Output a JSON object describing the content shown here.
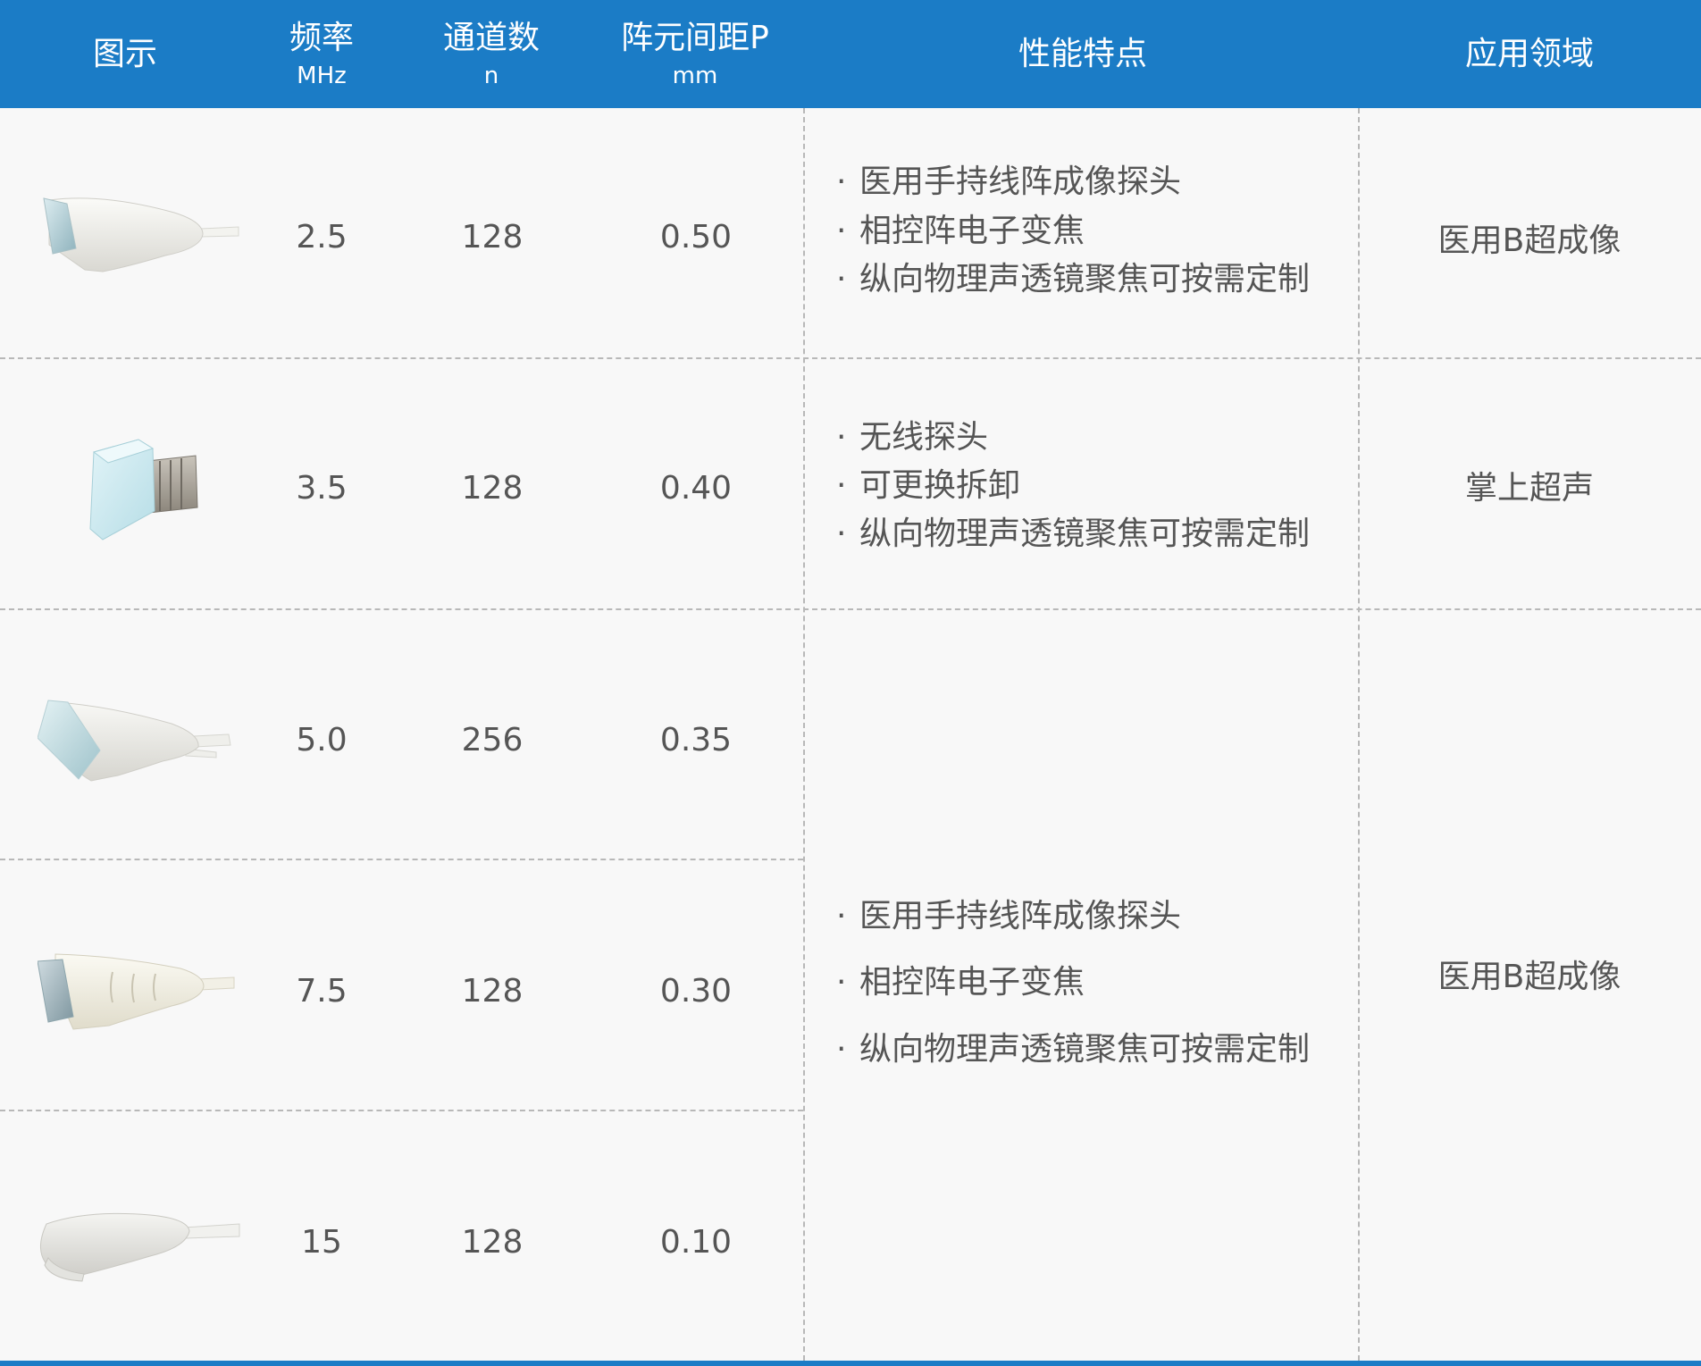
{
  "header": {
    "col_image": "图示",
    "col_freq": "频率",
    "col_freq_unit": "MHz",
    "col_channels": "通道数",
    "col_channels_unit": "n",
    "col_pitch": "阵元间距P",
    "col_pitch_unit": "mm",
    "col_features": "性能特点",
    "col_application": "应用领域"
  },
  "rows": [
    {
      "image": "linear-probe-icon",
      "freq": "2.5",
      "channels": "128",
      "pitch": "0.50"
    },
    {
      "image": "wireless-probe-icon",
      "freq": "3.5",
      "channels": "128",
      "pitch": "0.40"
    },
    {
      "image": "linear-probe-icon",
      "freq": "5.0",
      "channels": "256",
      "pitch": "0.35"
    },
    {
      "image": "linear-probe-icon",
      "freq": "7.5",
      "channels": "128",
      "pitch": "0.30"
    },
    {
      "image": "linear-probe-icon",
      "freq": "15",
      "channels": "128",
      "pitch": "0.10"
    }
  ],
  "features": {
    "group1": [
      "医用手持线阵成像探头",
      "相控阵电子变焦",
      "纵向物理声透镜聚焦可按需定制"
    ],
    "group2": [
      "无线探头",
      "可更换拆卸",
      "纵向物理声透镜聚焦可按需定制"
    ],
    "group3": [
      "医用手持线阵成像探头",
      "相控阵电子变焦",
      "纵向物理声透镜聚焦可按需定制"
    ]
  },
  "bullet": "·",
  "applications": {
    "group1": "医用B超成像",
    "group2": "掌上超声",
    "group3": "医用B超成像"
  },
  "colors": {
    "header_bg": "#1b7cc6",
    "header_text": "#ffffff",
    "body_bg": "#f8f8f8",
    "body_text": "#555555",
    "divider": "#b8b8b8"
  }
}
